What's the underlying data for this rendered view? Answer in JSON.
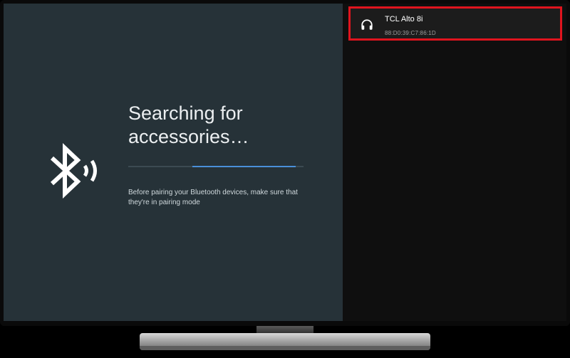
{
  "screen": {
    "title": "Searching for accessories…",
    "description": "Before pairing your Bluetooth devices, make sure that they're in pairing mode",
    "progress_fraction": 0.6
  },
  "devices": [
    {
      "name": "TCL Alto 8i",
      "address": "88:D0:39:C7:86:1D",
      "icon": "headphones-icon",
      "highlighted": true
    }
  ],
  "colors": {
    "screen_bg": "#263238",
    "panel_bg": "#0f0f0f",
    "accent": "#4a90d9",
    "highlight_border": "#e0141e"
  },
  "icons": [
    "bluetooth-searching-icon",
    "headphones-icon"
  ]
}
